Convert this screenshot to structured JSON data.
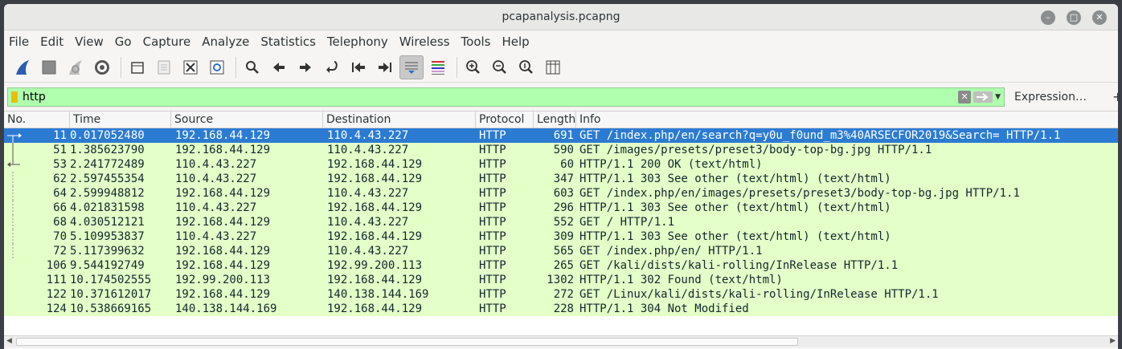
{
  "window": {
    "title": "pcapanalysis.pcapng"
  },
  "menu": [
    "File",
    "Edit",
    "View",
    "Go",
    "Capture",
    "Analyze",
    "Statistics",
    "Telephony",
    "Wireless",
    "Tools",
    "Help"
  ],
  "toolbar_icons": [
    "shark-fin-start-icon",
    "stop-square-icon",
    "restart-fin-icon",
    "capture-options-gear-icon",
    "open-folder-icon",
    "save-file-icon",
    "close-file-icon",
    "reload-file-icon",
    "find-packet-icon",
    "go-back-icon",
    "go-forward-icon",
    "go-to-packet-icon",
    "first-packet-icon",
    "last-packet-icon",
    "autoscroll-icon",
    "colorize-icon",
    "zoom-in-icon",
    "zoom-out-icon",
    "normal-size-icon",
    "resize-columns-icon"
  ],
  "filter": {
    "value": "http",
    "expression_label": "Expression…",
    "add_label": "+"
  },
  "columns": {
    "no": "No.",
    "time": "Time",
    "source": "Source",
    "destination": "Destination",
    "protocol": "Protocol",
    "length": "Length",
    "info": "Info"
  },
  "packets": [
    {
      "no": "11",
      "time": "0.017052480",
      "src": "192.168.44.129",
      "dst": "110.4.43.227",
      "proto": "HTTP",
      "len": "691",
      "info": "GET /index.php/en/search?q=y0u_f0und_m3%40ARSECFOR2019&Search= HTTP/1.1",
      "rel": "request"
    },
    {
      "no": "51",
      "time": "1.385623790",
      "src": "192.168.44.129",
      "dst": "110.4.43.227",
      "proto": "HTTP",
      "len": "590",
      "info": "GET /images/presets/preset3/body-top-bg.jpg HTTP/1.1",
      "rel": "line"
    },
    {
      "no": "53",
      "time": "2.241772489",
      "src": "110.4.43.227",
      "dst": "192.168.44.129",
      "proto": "HTTP",
      "len": "60",
      "info": "HTTP/1.1 200 OK  (text/html)",
      "rel": "response"
    },
    {
      "no": "62",
      "time": "2.597455354",
      "src": "110.4.43.227",
      "dst": "192.168.44.129",
      "proto": "HTTP",
      "len": "347",
      "info": "HTTP/1.1 303 See other  (text/html) (text/html)",
      "rel": "dash"
    },
    {
      "no": "64",
      "time": "2.599948812",
      "src": "192.168.44.129",
      "dst": "110.4.43.227",
      "proto": "HTTP",
      "len": "603",
      "info": "GET /index.php/en/images/presets/preset3/body-top-bg.jpg HTTP/1.1",
      "rel": "dash"
    },
    {
      "no": "66",
      "time": "4.021831598",
      "src": "110.4.43.227",
      "dst": "192.168.44.129",
      "proto": "HTTP",
      "len": "296",
      "info": "HTTP/1.1 303 See other  (text/html) (text/html)",
      "rel": "dash"
    },
    {
      "no": "68",
      "time": "4.030512121",
      "src": "192.168.44.129",
      "dst": "110.4.43.227",
      "proto": "HTTP",
      "len": "552",
      "info": "GET / HTTP/1.1",
      "rel": "dash"
    },
    {
      "no": "70",
      "time": "5.109953837",
      "src": "110.4.43.227",
      "dst": "192.168.44.129",
      "proto": "HTTP",
      "len": "309",
      "info": "HTTP/1.1 303 See other  (text/html) (text/html)",
      "rel": "dash"
    },
    {
      "no": "72",
      "time": "5.117399632",
      "src": "192.168.44.129",
      "dst": "110.4.43.227",
      "proto": "HTTP",
      "len": "565",
      "info": "GET /index.php/en/ HTTP/1.1",
      "rel": "dash"
    },
    {
      "no": "106",
      "time": "9.544192749",
      "src": "192.168.44.129",
      "dst": "192.99.200.113",
      "proto": "HTTP",
      "len": "265",
      "info": "GET /kali/dists/kali-rolling/InRelease HTTP/1.1",
      "rel": ""
    },
    {
      "no": "111",
      "time": "10.174502555",
      "src": "192.99.200.113",
      "dst": "192.168.44.129",
      "proto": "HTTP",
      "len": "1302",
      "info": "HTTP/1.1 302 Found  (text/html)",
      "rel": ""
    },
    {
      "no": "122",
      "time": "10.371612017",
      "src": "192.168.44.129",
      "dst": "140.138.144.169",
      "proto": "HTTP",
      "len": "272",
      "info": "GET /Linux/kali/dists/kali-rolling/InRelease HTTP/1.1",
      "rel": ""
    },
    {
      "no": "124",
      "time": "10.538669165",
      "src": "140.138.144.169",
      "dst": "192.168.44.129",
      "proto": "HTTP",
      "len": "228",
      "info": "HTTP/1.1 304 Not Modified",
      "rel": ""
    }
  ],
  "selected_packet": "11"
}
